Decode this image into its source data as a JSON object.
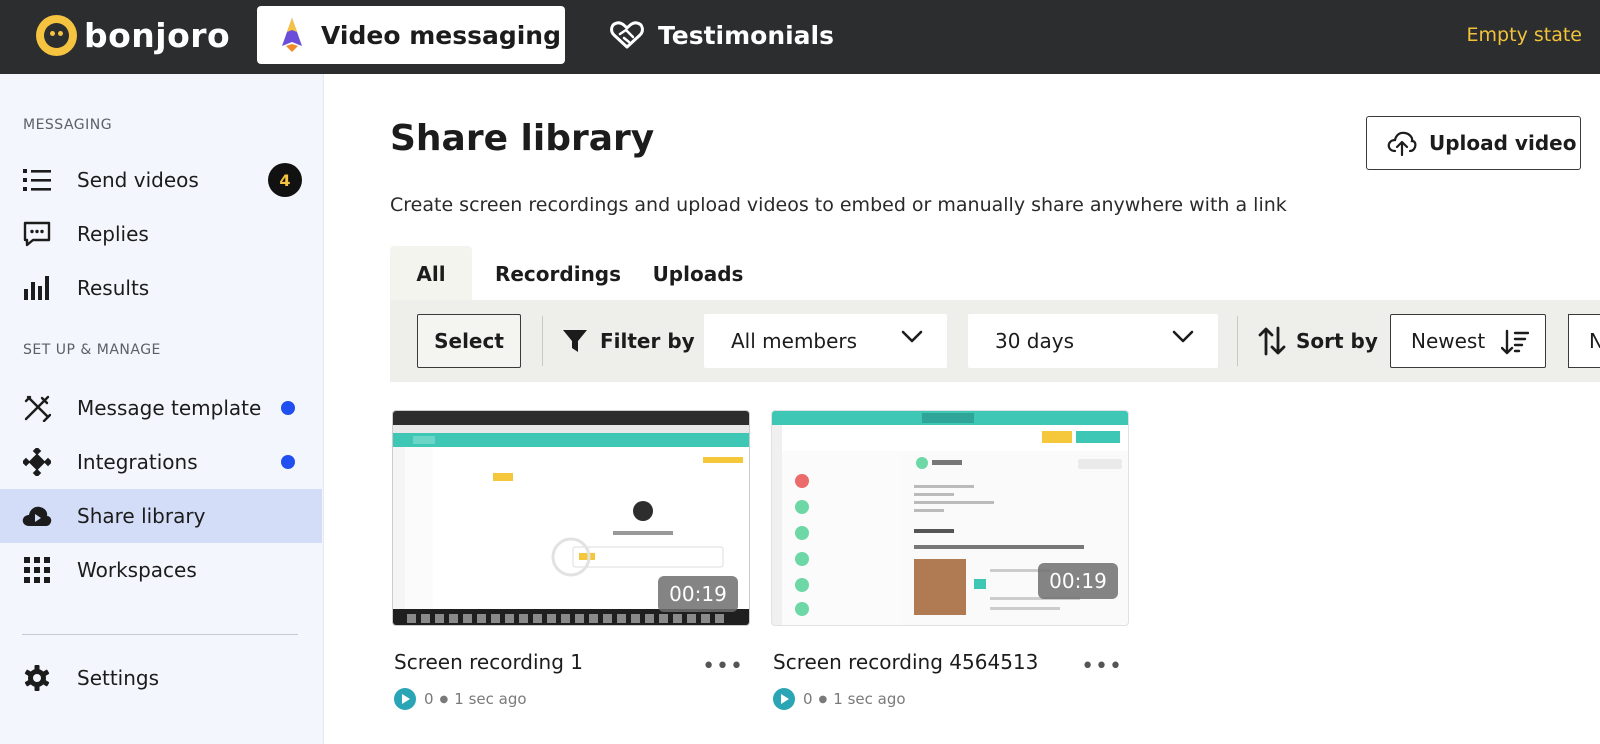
{
  "header": {
    "brand": "bonjoro",
    "tabs": [
      {
        "label": "Video messaging",
        "active": true,
        "icon": "rocket-icon"
      },
      {
        "label": "Testimonials",
        "active": false,
        "icon": "heart-handshake-icon"
      }
    ],
    "state_label": "Empty state"
  },
  "sidebar": {
    "sections": [
      {
        "label": "MESSAGING"
      },
      {
        "label": "SET UP & MANAGE"
      }
    ],
    "items": [
      {
        "label": "Send videos",
        "icon": "list-icon",
        "badge": "4"
      },
      {
        "label": "Replies",
        "icon": "chat-icon"
      },
      {
        "label": "Results",
        "icon": "bar-chart-icon"
      },
      {
        "label": "Message template",
        "icon": "tools-icon",
        "dot": true
      },
      {
        "label": "Integrations",
        "icon": "puzzle-icon",
        "dot": true
      },
      {
        "label": "Share library",
        "icon": "cloud-play-icon",
        "active": true
      },
      {
        "label": "Workspaces",
        "icon": "grid-icon"
      },
      {
        "label": "Settings",
        "icon": "gear-icon"
      }
    ]
  },
  "main": {
    "title": "Share library",
    "upload_label": "Upload video",
    "subtitle": "Create screen recordings and upload videos to embed or manually share anywhere with a link",
    "tabs": [
      "All",
      "Recordings",
      "Uploads"
    ],
    "active_tab": "All",
    "toolbar": {
      "select_label": "Select",
      "filter_label": "Filter by",
      "members_value": "All members",
      "days_value": "30 days",
      "sort_label": "Sort by",
      "sort_value": "Newest",
      "next_label": "N"
    },
    "videos": [
      {
        "title": "Screen recording 1",
        "duration": "00:19",
        "views": "0",
        "time": "1 sec ago"
      },
      {
        "title": "Screen recording 4564513",
        "duration": "00:19",
        "views": "0",
        "time": "1 sec ago"
      }
    ]
  },
  "colors": {
    "topbar": "#2b2d2f",
    "brand_yellow": "#f6c341",
    "state_yellow": "#f2c23a",
    "sidebar_bg": "#f3f6fc",
    "active_item": "#d3ddf8",
    "notify_dot": "#1f4ff0",
    "teal": "#2aa5b5",
    "toolbar_bg": "#eeeeea"
  }
}
